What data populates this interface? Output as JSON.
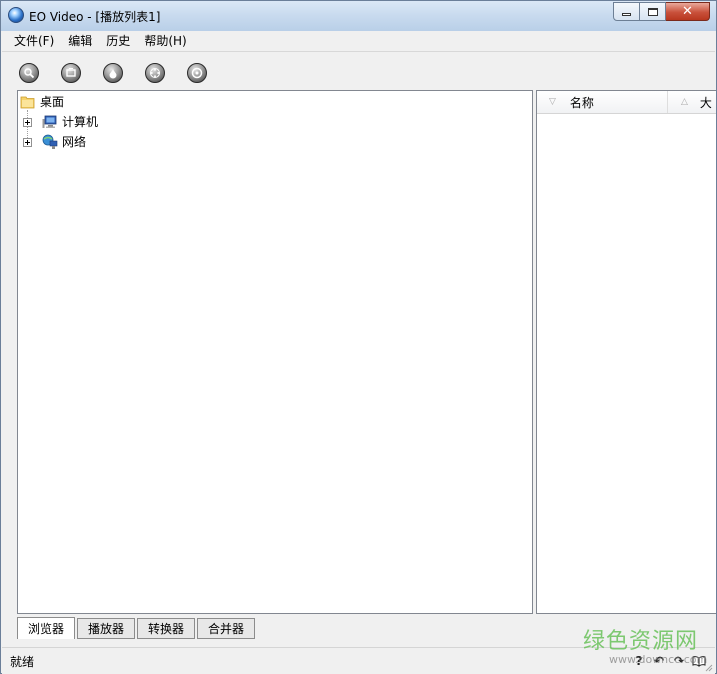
{
  "window": {
    "title": "EO Video - [播放列表1]"
  },
  "menubar": {
    "items": [
      {
        "label": "文件(F)"
      },
      {
        "label": "编辑"
      },
      {
        "label": "历史"
      },
      {
        "label": "帮助(H)"
      }
    ]
  },
  "toolbar": {
    "buttons": [
      {
        "icon": "search-icon"
      },
      {
        "icon": "screen-icon"
      },
      {
        "icon": "drop-icon"
      },
      {
        "icon": "film-reel-icon"
      },
      {
        "icon": "disc-icon"
      }
    ]
  },
  "tree": {
    "root": {
      "label": "桌面",
      "icon": "folder-icon"
    },
    "children": [
      {
        "label": "计算机",
        "icon": "computer-icon"
      },
      {
        "label": "网络",
        "icon": "network-icon"
      }
    ]
  },
  "list": {
    "columns": [
      {
        "label": "名称"
      },
      {
        "label": "大"
      }
    ]
  },
  "tabs": [
    {
      "label": "浏览器",
      "active": true
    },
    {
      "label": "播放器",
      "active": false
    },
    {
      "label": "转换器",
      "active": false
    },
    {
      "label": "合并器",
      "active": false
    }
  ],
  "statusbar": {
    "text": "就绪",
    "icons": [
      "help-icon",
      "undo-icon",
      "redo-icon",
      "book-icon"
    ]
  },
  "watermark": {
    "text": "绿色资源网",
    "url": "www.downcc.com"
  },
  "colors": {
    "title_gradient_top": "#dbe8f6",
    "close_button": "#c9513b",
    "panel_border": "#828790",
    "watermark_green": "#6ac25a"
  }
}
